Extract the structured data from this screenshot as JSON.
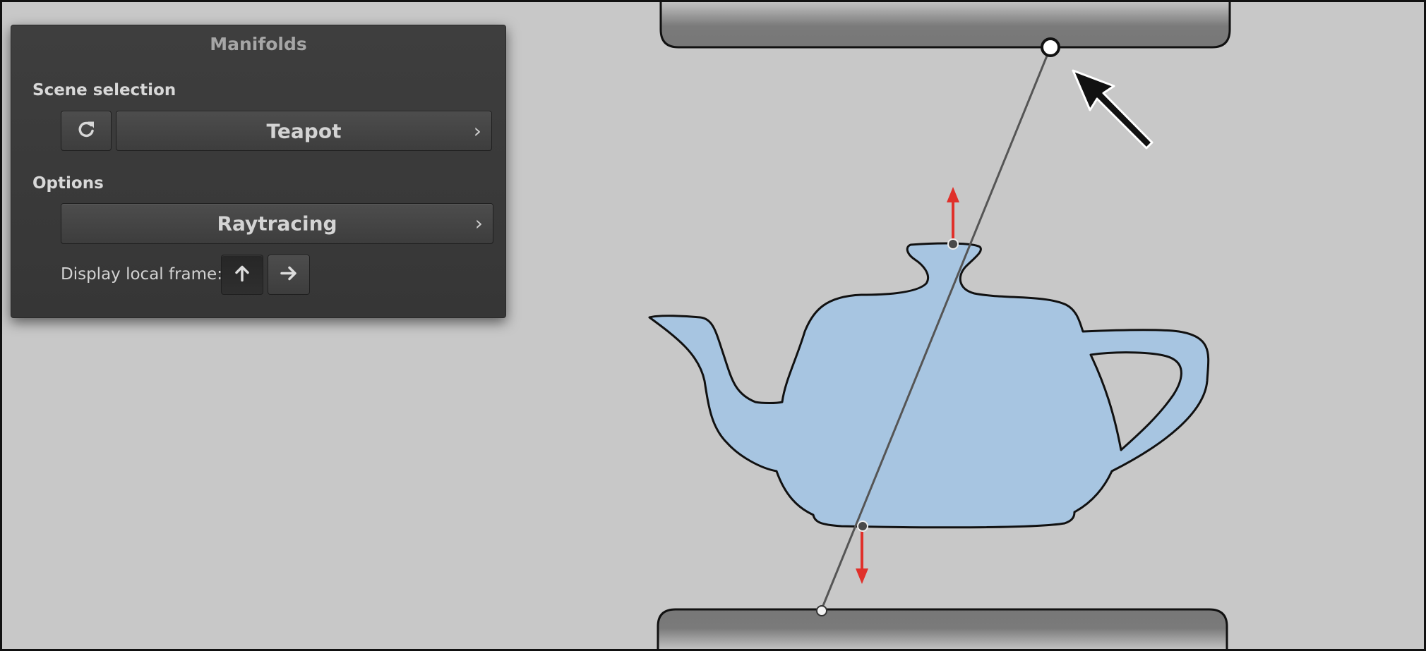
{
  "panel": {
    "title": "Manifolds",
    "scene_selection_label": "Scene selection",
    "scene_value": "Teapot",
    "options_label": "Options",
    "mode_value": "Raytracing",
    "display_local_frame_label": "Display local frame:",
    "reset_icon": "refresh-icon",
    "up_icon": "arrow-up-icon",
    "right_icon": "arrow-right-icon",
    "chevron_icon": "chevron-right-icon",
    "chevron_glyph": "›"
  },
  "colors": {
    "background": "#c8c8c8",
    "panel": "#3a3a3a",
    "teapot_fill": "#a7c5e1",
    "bar": "#787878",
    "normal_arrow": "#e0302a",
    "ray": "#555555"
  }
}
